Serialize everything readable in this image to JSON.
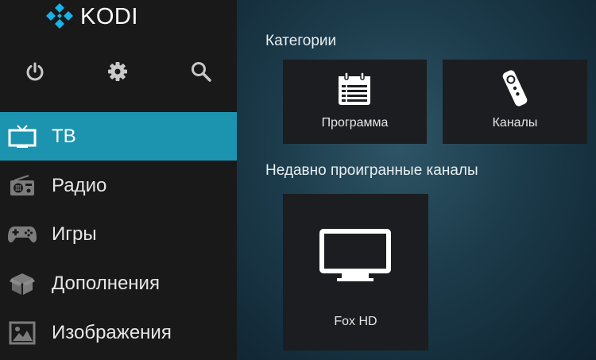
{
  "app": {
    "logo_text": "KODI",
    "accent": "#1c94b0",
    "logo_color": "#17b2e7"
  },
  "top_icons": [
    {
      "name": "power-icon"
    },
    {
      "name": "gear-icon"
    },
    {
      "name": "search-icon"
    }
  ],
  "nav": {
    "items": [
      {
        "label": "ТВ",
        "icon": "tv-icon",
        "active": true
      },
      {
        "label": "Радио",
        "icon": "radio-icon",
        "active": false
      },
      {
        "label": "Игры",
        "icon": "gamepad-icon",
        "active": false
      },
      {
        "label": "Дополнения",
        "icon": "addons-box-icon",
        "active": false
      },
      {
        "label": "Изображения",
        "icon": "picture-icon",
        "active": false
      }
    ]
  },
  "main": {
    "categories_title": "Категории",
    "categories": [
      {
        "label": "Программа",
        "icon": "calendar-icon"
      },
      {
        "label": "Каналы",
        "icon": "remote-icon"
      }
    ],
    "recent_title": "Недавно проигранные каналы",
    "recent": [
      {
        "label": "Fox HD",
        "icon": "tv-icon"
      }
    ]
  }
}
